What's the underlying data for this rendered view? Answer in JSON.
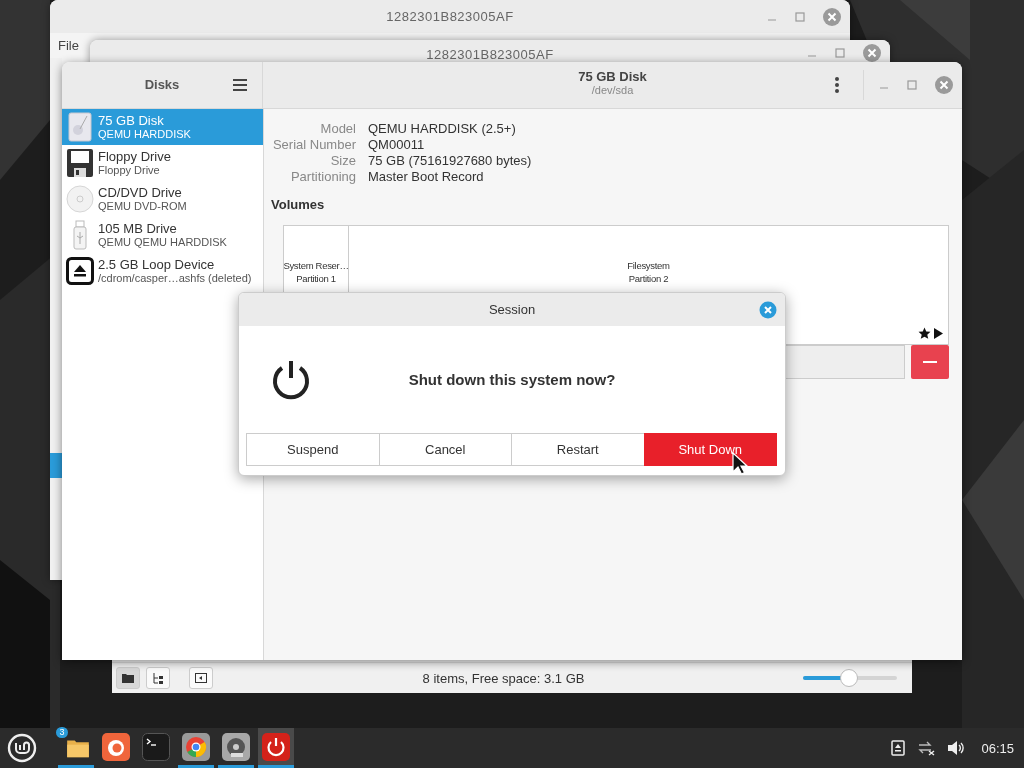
{
  "back_windows": [
    {
      "title": "1282301B823005AF",
      "menu": "File"
    },
    {
      "title": "1282301B823005AF"
    }
  ],
  "file_manager": {
    "status": "8 items, Free space: 3.1 GB",
    "zoom": {
      "level": 0.49
    }
  },
  "disks": {
    "sidebar_title": "Disks",
    "title": "75 GB Disk",
    "subtitle": "/dev/sda",
    "drives": [
      {
        "kind": "harddisk",
        "name": "75 GB Disk",
        "detail": "QEMU HARDDISK",
        "selected": true
      },
      {
        "kind": "floppy",
        "name": "Floppy Drive",
        "detail": "Floppy Drive",
        "selected": false
      },
      {
        "kind": "optical",
        "name": "CD/DVD Drive",
        "detail": "QEMU DVD-ROM",
        "selected": false
      },
      {
        "kind": "usb",
        "name": "105 MB Drive",
        "detail": "QEMU QEMU HARDDISK",
        "selected": false
      },
      {
        "kind": "loop",
        "name": "2.5 GB Loop Device",
        "detail": "/cdrom/casper…ashfs (deleted)",
        "selected": false
      }
    ],
    "properties": [
      {
        "label": "Model",
        "value": "QEMU HARDDISK (2.5+)"
      },
      {
        "label": "Serial Number",
        "value": "QM00011"
      },
      {
        "label": "Size",
        "value": "75 GB (75161927680 bytes)"
      },
      {
        "label": "Partitioning",
        "value": "Master Boot Record"
      }
    ],
    "volumes_heading": "Volumes",
    "partitions": [
      {
        "name": "System Reser…",
        "detail": "Partition 1"
      },
      {
        "name": "Filesystem",
        "detail": "Partition 2"
      }
    ]
  },
  "dialog": {
    "title": "Session",
    "message": "Shut down this system now?",
    "buttons": [
      {
        "label": "Suspend",
        "kind": "normal"
      },
      {
        "label": "Cancel",
        "kind": "normal"
      },
      {
        "label": "Restart",
        "kind": "normal"
      },
      {
        "label": "Shut Down",
        "kind": "destructive"
      }
    ]
  },
  "taskbar": {
    "apps": [
      {
        "kind": "files",
        "badge": "3",
        "running": true,
        "active": false
      },
      {
        "kind": "firefox",
        "running": false,
        "active": false
      },
      {
        "kind": "terminal",
        "running": false,
        "active": false
      },
      {
        "kind": "chrome",
        "running": true,
        "active": false
      },
      {
        "kind": "disks",
        "running": true,
        "active": false
      },
      {
        "kind": "session",
        "running": true,
        "active": true
      }
    ],
    "clock": "06:15"
  }
}
